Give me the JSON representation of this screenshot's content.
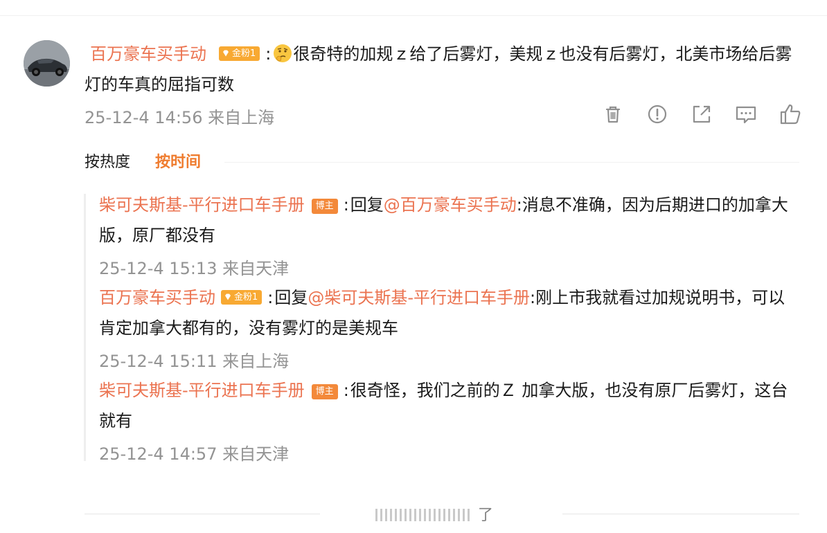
{
  "main_comment": {
    "username": "百万豪车买手动",
    "fan_badge": "金粉1",
    "colon": ":",
    "emoji": "thinking-emoji",
    "text": "很奇特的加规ｚ给了后雾灯，美规ｚ也没有后雾灯，北美市场给后雾灯的车真的屈指可数",
    "meta": "25-12-4 14:56 来自上海",
    "actions": [
      "delete-icon",
      "report-icon",
      "share-icon",
      "comment-icon",
      "like-icon"
    ]
  },
  "sort": {
    "by_heat": "按热度",
    "by_time": "按时间"
  },
  "replies": [
    {
      "username": "柴可夫斯基-平行进口车手册",
      "badge": "博主",
      "colon": ":",
      "reply_prefix": "回复",
      "reply_to": "@百万豪车买手动",
      "text": ":消息不准确，因为后期进口的加拿大版，原厂都没有",
      "meta": "25-12-4 15:13 来自天津"
    },
    {
      "username": "百万豪车买手动",
      "badge": "金粉1",
      "colon": ":",
      "reply_prefix": "回复",
      "reply_to": "@柴可夫斯基-平行进口车手册",
      "text": ":刚上市我就看过加规说明书，可以肯定加拿大都有的，没有雾灯的是美规车",
      "meta": "25-12-4 15:11 来自上海"
    },
    {
      "username": "柴可夫斯基-平行进口车手册",
      "badge": "博主",
      "colon": ":",
      "text": "很奇怪，我们之前的Ｚ 加拿大版，也没有原厂后雾灯，这台就有",
      "meta": "25-12-4 14:57 来自天津"
    }
  ],
  "footer": {
    "end_text": "了"
  },
  "colors": {
    "username": "#eb7350",
    "fan_badge": "#f8a932",
    "blogger_badge": "#f3893a",
    "active_sort": "#ef7c2f",
    "meta": "#939393"
  }
}
